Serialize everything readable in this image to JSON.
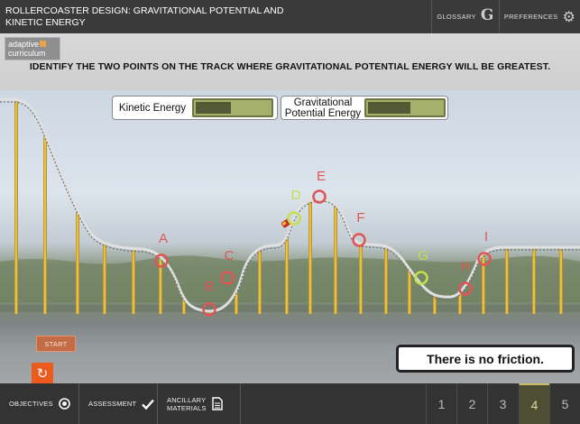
{
  "header": {
    "title": "Rollercoaster Design: Gravitational Potential and Kinetic Energy",
    "glossary_label": "Glossary",
    "glossary_icon": "g",
    "preferences_label": "Preferences",
    "preferences_icon": "⚙"
  },
  "logo": {
    "line1": "adaptive",
    "line2": "curriculum"
  },
  "instruction": "Identify the two points on the track where gravitational potential energy will be greatest.",
  "meters": {
    "kinetic": {
      "label": "Kinetic Energy",
      "level": 0.45
    },
    "gravitational": {
      "label_line1": "Gravitational",
      "label_line2": "Potential Energy",
      "level": 0.55
    }
  },
  "points": [
    {
      "label": "A",
      "color": "#e05555"
    },
    {
      "label": "B",
      "color": "#e05555"
    },
    {
      "label": "C",
      "color": "#e05555"
    },
    {
      "label": "D",
      "color": "#c4e04a"
    },
    {
      "label": "E",
      "color": "#e05555"
    },
    {
      "label": "F",
      "color": "#e05555"
    },
    {
      "label": "G",
      "color": "#c4e04a"
    },
    {
      "label": "H",
      "color": "#e05555"
    },
    {
      "label": "I",
      "color": "#e05555"
    }
  ],
  "controls": {
    "start_label": "Start",
    "reset_icon": "↻"
  },
  "note": "There is no friction.",
  "footer": {
    "objectives_label": "Objectives",
    "assessment_label": "Assessment",
    "ancillary_line1": "Ancillary",
    "ancillary_line2": "Materials",
    "pages": [
      "1",
      "2",
      "3",
      "4",
      "5"
    ],
    "active_page": "4"
  }
}
